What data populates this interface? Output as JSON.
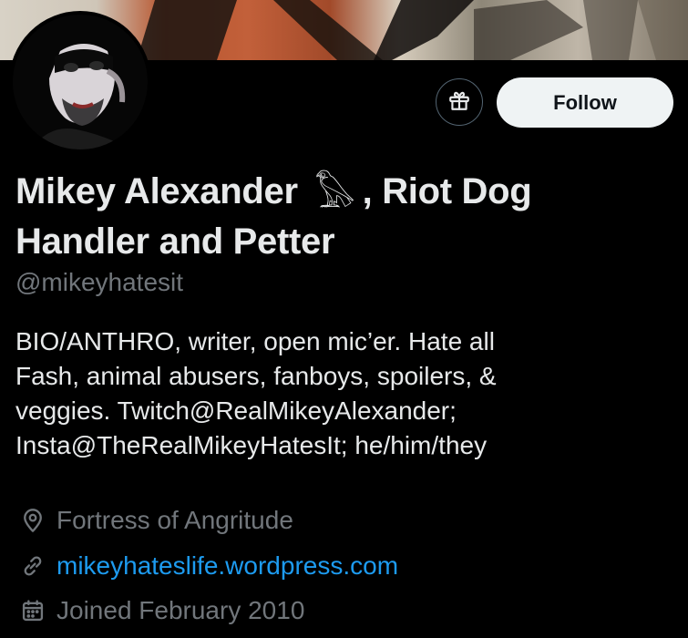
{
  "colors": {
    "background": "#000000",
    "primary_text": "#e7e9ea",
    "secondary_text": "#71767b",
    "link": "#1d9bf0",
    "follow_button_bg": "#eff3f4"
  },
  "header": {
    "gift_icon": "gift-icon",
    "follow_label": "Follow"
  },
  "profile": {
    "name_part1": "Mikey Alexander",
    "name_emoji": "𓅃",
    "name_part2": ", Riot Dog",
    "name_line2": "Handler and Petter",
    "handle": "@mikeyhatesit",
    "bio_lines": [
      "BIO/ANTHRO, writer, open mic’er. Hate all",
      "Fash, animal abusers, fanboys, spoilers, &",
      "veggies. Twitch@RealMikeyAlexander;",
      "Insta@TheRealMikeyHatesIt; he/him/they"
    ],
    "location_icon": "location-pin-icon",
    "location": "Fortress of Angritude",
    "url_icon": "link-icon",
    "url": "mikeyhateslife.wordpress.com",
    "joined_icon": "calendar-icon",
    "joined": "Joined February 2010"
  }
}
